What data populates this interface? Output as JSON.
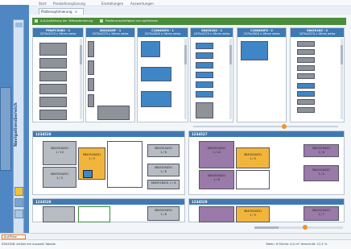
{
  "menu": [
    "Start",
    "Produktionsplanung",
    "Einstellungen",
    "Auswertungen"
  ],
  "doc_tab": "Plattenoptimierung",
  "toolbar": {
    "item1": "Auf-/Aufteilung der Tafeloptimierung",
    "item2": "Plattenzuschnittplan neu optimieren"
  },
  "nav": {
    "label": "Navigationsbereich"
  },
  "sheets": [
    {
      "title": "PMAPCSHB2 - 1",
      "sub": "2070x2070 x 16mm weiss"
    },
    {
      "title": "SD0402MF - 1",
      "sub": "2070x2070 x 16mm weiss"
    },
    {
      "title": "C10B450F8 - 1",
      "sub": "2070x2800 x 16mm weiss"
    },
    {
      "title": "SB4551NZ - 1",
      "sub": "2070x2070 x 16mm weiss"
    },
    {
      "title": "C10B450F8 - 2",
      "sub": "2070x2800 x 16mm weiss"
    },
    {
      "title": "SB4551NZ - 2",
      "sub": "2070x2070 x 16mm weiss"
    }
  ],
  "details": [
    {
      "title": "1234528"
    },
    {
      "title": "1234527"
    }
  ],
  "lower": [
    {
      "title": "1234528"
    },
    {
      "title": "1234529"
    }
  ],
  "pieces": {
    "gray_a": {
      "code": "SB4551NZ01",
      "qty": "1 / 10"
    },
    "gray_b": {
      "code": "SB4551NZ01",
      "qty": "1 / 3"
    },
    "gray_c": {
      "code": "SB4551NZ01",
      "qty": "1 / 8"
    },
    "orange_a": {
      "code": "SB4551NZ01",
      "qty": "1 / 5"
    },
    "gray_r1": {
      "code": "SB4551NZ01",
      "qty": "1 / 8"
    },
    "gray_r2": {
      "code": "SB4551NZ01",
      "qty": "1 / 8"
    },
    "purple_a": {
      "code": "SB4551NZ01",
      "qty": "1 / 10"
    },
    "orange_b": {
      "code": "SB4551NZ01",
      "qty": "1 / 9"
    },
    "purple_b": {
      "code": "SB4551NZ01",
      "qty": "1 / 8"
    },
    "purple_r1": {
      "code": "SB4551NZ01",
      "qty": "1 / 8"
    },
    "purple_r2": {
      "code": "SB4551NZ01",
      "qty": "1 / 8"
    },
    "lower_gray": {
      "code": "SB4551NZ01",
      "qty": "1 / 8"
    },
    "lower_orange": {
      "code": "SB4551NZ01",
      "qty": "1 / 9"
    },
    "lower_purple": {
      "code": "SB4551NZ01",
      "qty": "1 / 7"
    }
  },
  "activebar": "Auf-Platz",
  "status": {
    "left": "E5K4308: Artikel mit Auswahl Tabelle",
    "right": "Tafeln: 6  Fläche: 6,0 m²  Verschnitt: 12,5 %"
  },
  "colors": {
    "accent_blue": "#3f79b3",
    "nav_blue": "#4f87c4",
    "toolbar_green": "#4a8d3a",
    "highlight_orange": "#f2b53c",
    "piece_purple": "#9a7aa8"
  }
}
